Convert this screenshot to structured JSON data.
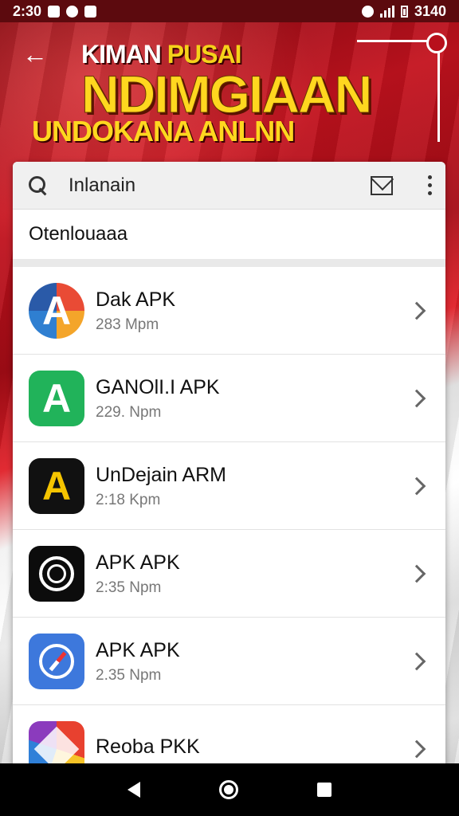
{
  "status_bar": {
    "time": "2:30",
    "right_text": "3140"
  },
  "header": {
    "line1_white": "KIMAN ",
    "line1_yellow": "PUSAI",
    "line2": "NDIMGIAAN",
    "line3": "UNDOKANA ANLNN"
  },
  "search": {
    "query": "Inlanain"
  },
  "section_title": "Otenlouaaa",
  "apps": [
    {
      "name": "Dak APK",
      "meta": "283 Mpm",
      "icon": "triangle-a-icon"
    },
    {
      "name": "GANOlI.I APK",
      "meta": "229. Npm",
      "icon": "green-a-icon"
    },
    {
      "name": "UnDejain ARM",
      "meta": "2:18 Kpm",
      "icon": "yellow-a-icon"
    },
    {
      "name": "APK APK",
      "meta": "2:35 Npm",
      "icon": "ring-icon"
    },
    {
      "name": "APK APK",
      "meta": "2.35 Npm",
      "icon": "compass-icon"
    },
    {
      "name": "Reoba PKK",
      "meta": "",
      "icon": "cube-icon"
    }
  ],
  "colors": {
    "flag_red": "#c4121e",
    "accent_yellow": "#ffd71f",
    "nav_bg": "#000000"
  }
}
